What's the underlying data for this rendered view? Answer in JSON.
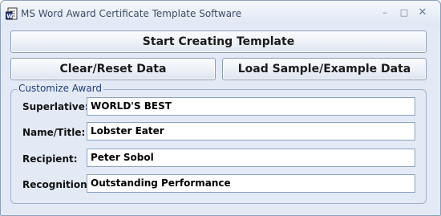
{
  "window": {
    "title": "MS Word Award Certificate Template Software",
    "controls": {
      "minimize": "–",
      "maximize": "□",
      "close": "✕"
    }
  },
  "buttons": {
    "start": "Start Creating Template",
    "clear": "Clear/Reset Data",
    "load": "Load Sample/Example Data"
  },
  "customize": {
    "legend": "Customize Award",
    "fields": [
      {
        "label": "Superlative:",
        "value": "WORLD'S BEST"
      },
      {
        "label": "Name/Title:",
        "value": "Lobster Eater"
      },
      {
        "label": "Recipient:",
        "value": "Peter Sobol"
      },
      {
        "label": "Recognition:",
        "value": "Outstanding Performance"
      }
    ]
  },
  "colors": {
    "window_bg": "#e3eaf6",
    "legend_text": "#1f3f7a",
    "border": "#8ba0bf"
  },
  "icons": {
    "app": "word-document-icon"
  }
}
